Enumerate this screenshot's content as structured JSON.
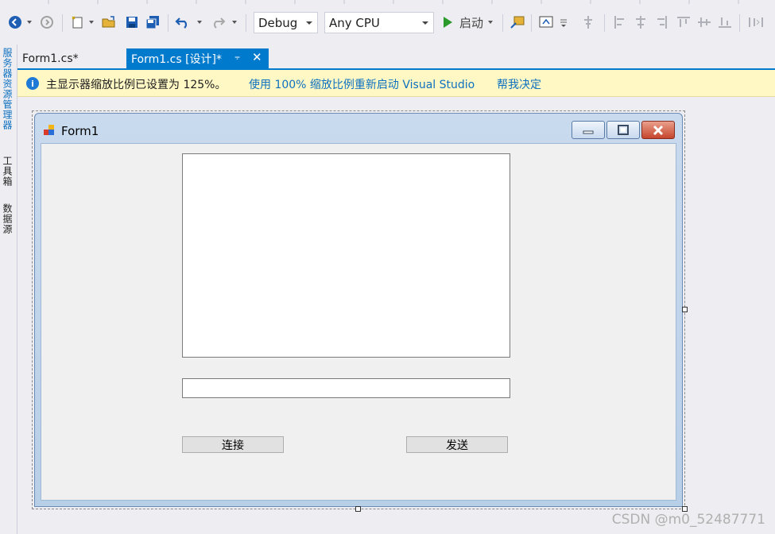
{
  "toolbar": {
    "config_dropdown": "Debug",
    "platform_dropdown": "Any CPU",
    "start_label": "启动"
  },
  "left_strip": {
    "items": [
      "服务器资源管理器",
      "工具箱",
      "数据源"
    ]
  },
  "tabs": [
    {
      "label": "Form1.cs*"
    },
    {
      "label": "Form1.cs [设计]*"
    }
  ],
  "infobar": {
    "message": "主显示器缩放比例已设置为 125%。",
    "link_restart": "使用 100% 缩放比例重新启动 Visual Studio",
    "link_decide": "帮我决定"
  },
  "form": {
    "title": "Form1",
    "connect_button": "连接",
    "send_button": "发送"
  },
  "watermark": "CSDN @m0_52487771",
  "colors": {
    "accent": "#007acc",
    "infobar_bg": "#fff8c5",
    "link": "#0e70c0"
  }
}
